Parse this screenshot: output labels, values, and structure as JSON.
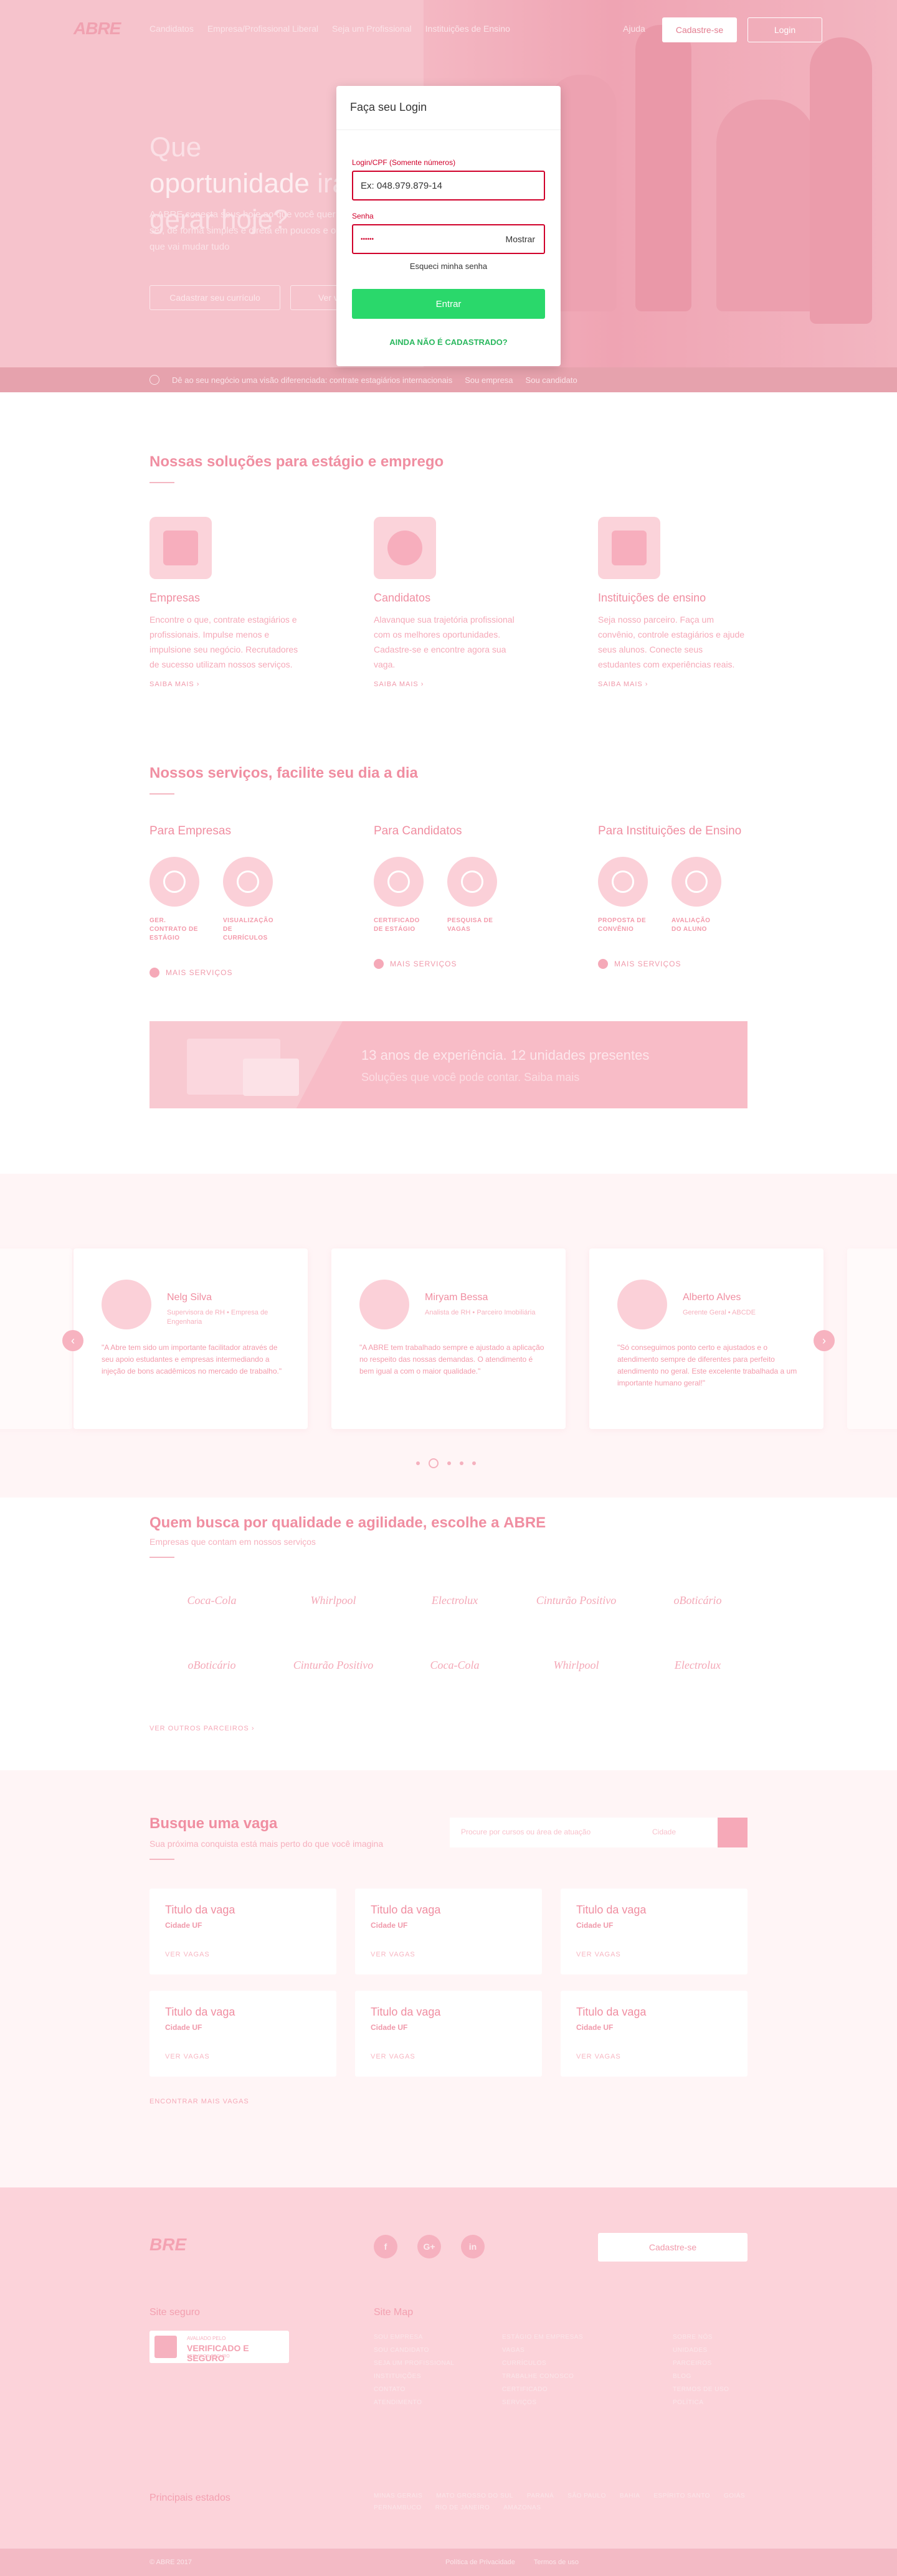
{
  "nav": {
    "logo": "ABRE",
    "logo_sub": "",
    "links": [
      "Candidatos",
      "Empresa/Profissional Liberal",
      "Seja um Profissional",
      "Instituições de Ensino"
    ],
    "help": "Ajuda",
    "signup": "Cadastre-se",
    "login": "Login"
  },
  "hero": {
    "title_a": "Que ",
    "title_b": "oportunidade",
    "title_c": " irá gerar hoje?",
    "lead": "A ABRE conecta seus hoje ao que você quer ser, de forma simples e direta em poucos e o que vai mudar tudo",
    "cta_primary": "Cadastrar seu currículo",
    "cta_secondary": "Ver vagas",
    "bar_text": "Dê ao seu negócio uma visão diferenciada: contrate estagiários internacionais",
    "bar_link1": "Sou empresa",
    "bar_link2": "Sou candidato"
  },
  "login": {
    "title": "Faça seu Login",
    "user_label": "Login/CPF (Somente números)",
    "user_value": "Ex: 048.979.879-14",
    "pass_label": "Senha",
    "pass_value": "••••••",
    "show": "Mostrar",
    "forgot": "Esqueci minha senha",
    "enter": "Entrar",
    "not_registered": "AINDA NÃO É CADASTRADO?"
  },
  "solutions": {
    "title": "Nossas soluções para estágio e emprego",
    "items": [
      {
        "title": "Empresas",
        "text": "Encontre o que, contrate estagiários e profissionais. Impulse menos e impulsione seu negócio. Recrutadores de sucesso utilizam nossos serviços.",
        "link": "SAIBA MAIS ›"
      },
      {
        "title": "Candidatos",
        "text": "Alavanque sua trajetória profissional com os melhores oportunidades. Cadastre-se e encontre agora sua vaga.",
        "link": "SAIBA MAIS ›"
      },
      {
        "title": "Instituições de ensino",
        "text": "Seja nosso parceiro. Faça um convênio, controle estagiários e ajude seus alunos. Conecte seus estudantes com experiências reais.",
        "link": "SAIBA MAIS ›"
      }
    ]
  },
  "services": {
    "title": "Nossos serviços, facilite seu dia a dia",
    "groups": [
      {
        "title": "Para Empresas",
        "items": [
          "GER. CONTRATO DE ESTÁGIO",
          "VISUALIZAÇÃO DE CURRÍCULOS"
        ],
        "more": "MAIS SERVIÇOS"
      },
      {
        "title": "Para Candidatos",
        "items": [
          "CERTIFICADO DE ESTÁGIO",
          "PESQUISA DE VAGAS"
        ],
        "more": "MAIS SERVIÇOS"
      },
      {
        "title": "Para Instituições de Ensino",
        "items": [
          "PROPOSTA DE CONVÊNIO",
          "AVALIAÇÃO DO ALUNO"
        ],
        "more": "MAIS SERVIÇOS"
      }
    ]
  },
  "banner": {
    "line1": "13 anos de experiência. 12 unidades presentes",
    "line2": "Soluções que você pode contar. Saiba mais"
  },
  "testimonials": {
    "cards": [
      {
        "name": "Nelg Silva",
        "role": "Supervisora de RH • Empresa de Engenharia",
        "text": "\"A Abre tem sido um importante facilitador através de seu apoio estudantes e empresas intermediando a injeção de bons acadêmicos no mercado de trabalho.\""
      },
      {
        "name": "Miryam Bessa",
        "role": "Analista de RH • Parceiro Imobiliária",
        "text": "\"A ABRE tem trabalhado sempre e ajustado a aplicação no respeito das nossas demandas. O atendimento é bem igual a com o maior qualidade.\""
      },
      {
        "name": "Alberto Alves",
        "role": "Gerente Geral • ABCDE",
        "text": "\"Só conseguimos ponto certo e ajustados e o atendimento sempre de diferentes para perfeito atendimento no geral. Este excelente trabalhada a um importante humano geral!\""
      }
    ]
  },
  "clients": {
    "title_a": "Quem busca por qualidade e agilidade, escolhe a ",
    "title_b": "ABRE",
    "subtitle": "Empresas que contam em nossos serviços",
    "row1": [
      "Coca-Cola",
      "Whirlpool",
      "Electrolux",
      "Cinturão Positivo",
      "oBoticário"
    ],
    "row2": [
      "oBoticário",
      "Cinturão Positivo",
      "Coca-Cola",
      "Whirlpool",
      "Electrolux"
    ],
    "see_more": "VER OUTROS PARCEIROS ›"
  },
  "jobs": {
    "title": "Busque uma vaga",
    "subtitle": "Sua próxima conquista está mais perto do que você imagina",
    "search_placeholder": "Procure por cursos ou área de atuação",
    "city_placeholder": "Cidade",
    "cards": [
      {
        "title": "Titulo da vaga",
        "city": "Cidade UF",
        "link": "VER VAGAS"
      },
      {
        "title": "Titulo da vaga",
        "city": "Cidade UF",
        "link": "VER VAGAS"
      },
      {
        "title": "Titulo da vaga",
        "city": "Cidade UF",
        "link": "VER VAGAS"
      },
      {
        "title": "Titulo da vaga",
        "city": "Cidade UF",
        "link": "VER VAGAS"
      },
      {
        "title": "Titulo da vaga",
        "city": "Cidade UF",
        "link": "VER VAGAS"
      },
      {
        "title": "Titulo da vaga",
        "city": "Cidade UF",
        "link": "VER VAGAS"
      }
    ],
    "all": "ENCONTRAR MAIS VAGAS"
  },
  "footer": {
    "logo": "BRE",
    "social": [
      "f",
      "G+",
      "in"
    ],
    "signup": "Cadastre-se",
    "secure_title": "Site seguro",
    "seal_top": "AVALIADO PELO",
    "seal_main": "VERIFICADO E SEGURO",
    "seal_bottom": "SERVIDOR SEGURO",
    "sitemap_title": "Site Map",
    "col1": [
      "SOU EMPRESA",
      "SOU CANDIDATO",
      "SEJA UM PROFISSIONAL",
      "INSTITUIÇÕES",
      "CONTATO",
      "ATENDIMENTO"
    ],
    "col2": [
      "ESTÁGIO EM EMPRESAS",
      "VAGAS",
      "CURRÍCULOS",
      "TRABALHE CONOSCO",
      "CERTIFICADO",
      "SERVIÇOS"
    ],
    "col3": [
      "SOBRE NÓS",
      "UNIDADES",
      "PARCEIROS",
      "BLOG",
      "TERMOS DE USO",
      "POLÍTICA"
    ],
    "states_title": "Principais estados",
    "states": [
      "MINAS GERAIS",
      "MATO GROSSO DO SUL",
      "PARANÁ",
      "SÃO PAULO",
      "BAHIA",
      "ESPÍRITO SANTO",
      "GOIÁS",
      "PERNAMBUCO",
      "RIO DE JANEIRO",
      "AMAZONAS"
    ],
    "copyright": "© ABRE 2017",
    "bottom_links": [
      "Política de Privacidade",
      "Termos de uso"
    ]
  },
  "colors": {
    "accent": "#e37d90",
    "login_red": "#d0002a",
    "enter_green": "#2ad86b"
  }
}
